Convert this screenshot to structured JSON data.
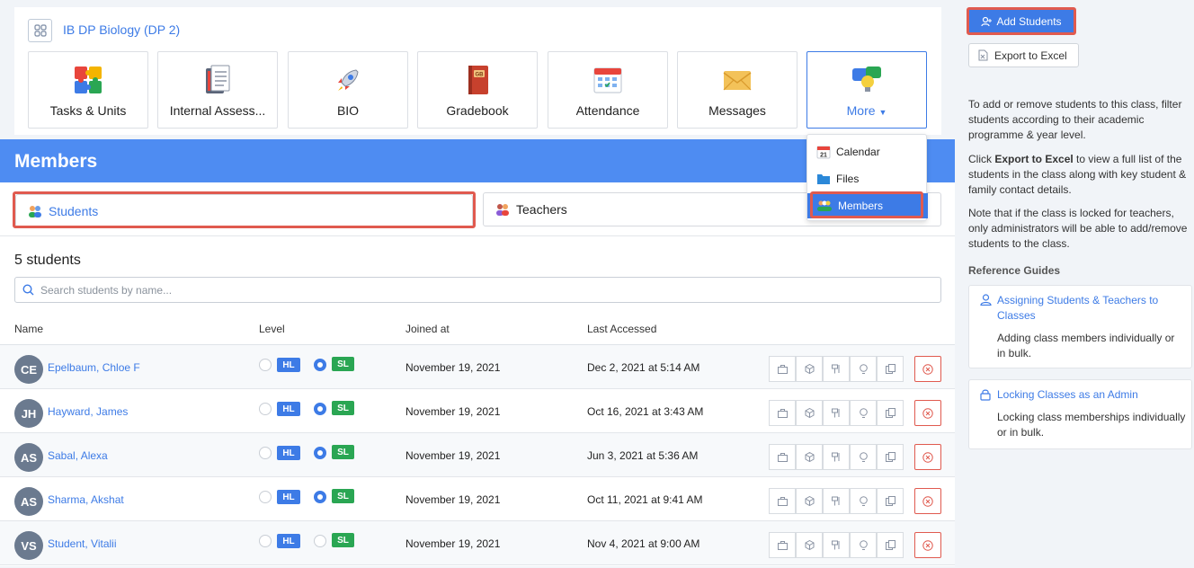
{
  "class": {
    "title": "IB DP Biology (DP 2)"
  },
  "tiles": [
    {
      "label": "Tasks & Units",
      "icon": "puzzle-icon"
    },
    {
      "label": "Internal Assess...",
      "icon": "notebook-icon"
    },
    {
      "label": "BIO",
      "icon": "rocket-icon"
    },
    {
      "label": "Gradebook",
      "icon": "gradebook-icon"
    },
    {
      "label": "Attendance",
      "icon": "calendar-grid-icon"
    },
    {
      "label": "Messages",
      "icon": "envelope-icon"
    },
    {
      "label": "More",
      "icon": "chat-bulb-icon"
    }
  ],
  "members": {
    "title": "Members",
    "tabs": {
      "students": "Students",
      "teachers": "Teachers"
    },
    "count": "5 students",
    "search_placeholder": "Search students by name...",
    "columns": {
      "name": "Name",
      "level": "Level",
      "joined": "Joined at",
      "last": "Last Accessed"
    },
    "level_labels": {
      "hl": "HL",
      "sl": "SL"
    },
    "students": [
      {
        "initials": "CE",
        "name": "Epelbaum, Chloe F",
        "level": "SL",
        "joined": "November 19, 2021",
        "last": "Dec 2, 2021 at 5:14 AM"
      },
      {
        "initials": "JH",
        "name": "Hayward, James",
        "level": "SL",
        "joined": "November 19, 2021",
        "last": "Oct 16, 2021 at 3:43 AM"
      },
      {
        "initials": "AS",
        "name": "Sabal, Alexa",
        "level": "SL",
        "joined": "November 19, 2021",
        "last": "Jun 3, 2021 at 5:36 AM"
      },
      {
        "initials": "AS",
        "name": "Sharma, Akshat",
        "level": "SL",
        "joined": "November 19, 2021",
        "last": "Oct 11, 2021 at 9:41 AM"
      },
      {
        "initials": "VS",
        "name": "Student, Vitalii",
        "level": "",
        "joined": "November 19, 2021",
        "last": "Nov 4, 2021 at 9:00 AM"
      }
    ]
  },
  "dropdown": {
    "items": [
      "Calendar",
      "Files",
      "Members"
    ],
    "calendar_date": "21",
    "active": "Members"
  },
  "sidebar": {
    "add_students": "Add Students",
    "export_excel": "Export to Excel",
    "help1": "To add or remove students to this class, filter students according to their academic programme & year level.",
    "help2_pre": "Click ",
    "help2_bold": "Export to Excel",
    "help2_post": " to view a full list of the students in the class along with key student & family contact details.",
    "help3": "Note that if the class is locked for teachers, only administrators will be able to add/remove students to the class.",
    "ref_heading": "Reference Guides",
    "guides": [
      {
        "title": "Assigning Students & Teachers to Classes",
        "desc": "Adding class members individually or in bulk."
      },
      {
        "title": "Locking Classes as an Admin",
        "desc": "Locking class memberships individually or in bulk."
      }
    ]
  },
  "colors": {
    "accent": "#3d7be6",
    "header": "#4e8cf2",
    "hl": "#3d7be6",
    "sl": "#2aa653",
    "danger": "#e05a4f"
  }
}
